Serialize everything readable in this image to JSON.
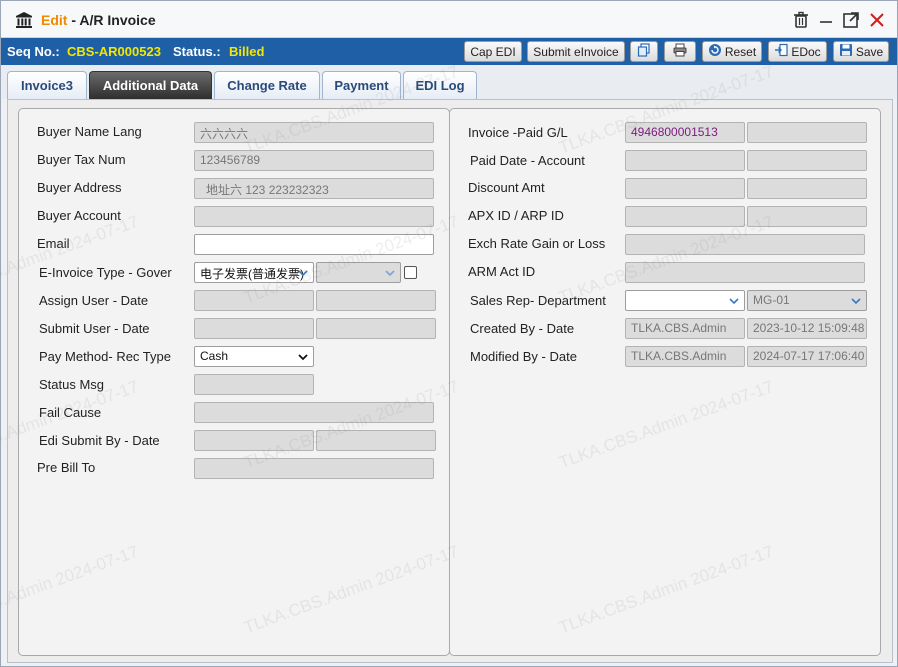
{
  "title": {
    "mode": "Edit",
    "separator": " - ",
    "name": "A/R Invoice"
  },
  "status_bar": {
    "seq_label": "Seq No.:",
    "seq_value": "CBS-AR000523",
    "status_label": "Status.:",
    "status_value": "Billed",
    "buttons": {
      "cap_edi": "Cap EDI",
      "submit_einvoice": "Submit eInvoice",
      "reset": "Reset",
      "edoc": "EDoc",
      "save": "Save"
    }
  },
  "tabs": [
    "Invoice3",
    "Additional Data",
    "Change Rate",
    "Payment",
    "EDI Log"
  ],
  "active_tab": "Additional Data",
  "left": {
    "buyer_name_lang": {
      "label": "Buyer Name Lang",
      "value": "六六六六"
    },
    "buyer_tax_num": {
      "label": "Buyer Tax Num",
      "value": "123456789"
    },
    "buyer_address": {
      "label": "Buyer Address",
      "value": "地址六 123 223232323"
    },
    "buyer_account": {
      "label": "Buyer Account",
      "value": ""
    },
    "email": {
      "label": "Email",
      "value": ""
    },
    "einvoice_type": {
      "label": "E-Invoice Type -  Gover",
      "value": "电子发票(普通发票)",
      "gover_value": ""
    },
    "assign_user": {
      "label": "Assign User -  Date"
    },
    "submit_user": {
      "label": "Submit User -  Date"
    },
    "pay_method": {
      "label": "Pay Method-  Rec Type",
      "value": "Cash"
    },
    "status_msg": {
      "label": "Status Msg",
      "value": ""
    },
    "fail_cause": {
      "label": "Fail Cause",
      "value": ""
    },
    "edi_submit_by": {
      "label": "Edi Submit By -  Date"
    },
    "pre_bill_to": {
      "label": "Pre Bill To",
      "value": ""
    }
  },
  "right": {
    "invoice_paid_gl": {
      "label": "Invoice -Paid G/L",
      "value": "4946800001513",
      "value2": ""
    },
    "paid_date": {
      "label": "Paid Date -  Account"
    },
    "discount_amt": {
      "label": "Discount Amt"
    },
    "apx_arp": {
      "label": "APX ID / ARP ID"
    },
    "exch_rate": {
      "label": "Exch Rate Gain or Loss"
    },
    "arm_act": {
      "label": "ARM Act ID"
    },
    "sales_rep": {
      "label": "Sales Rep-  Department",
      "rep_value": "",
      "dept_value": "MG-01"
    },
    "created_by": {
      "label": "Created By -  Date",
      "user": "TLKA.CBS.Admin",
      "date": "2023-10-12 15:09:48"
    },
    "modified_by": {
      "label": "Modified By -  Date",
      "user": "TLKA.CBS.Admin",
      "date": "2024-07-17 17:06:40"
    }
  },
  "watermark": "TLKA.CBS.Admin 2024-07-17",
  "colors": {
    "status_bar": "#1f5fa6",
    "accent_yellow": "#f2e700",
    "edit_orange": "#f08a00"
  }
}
